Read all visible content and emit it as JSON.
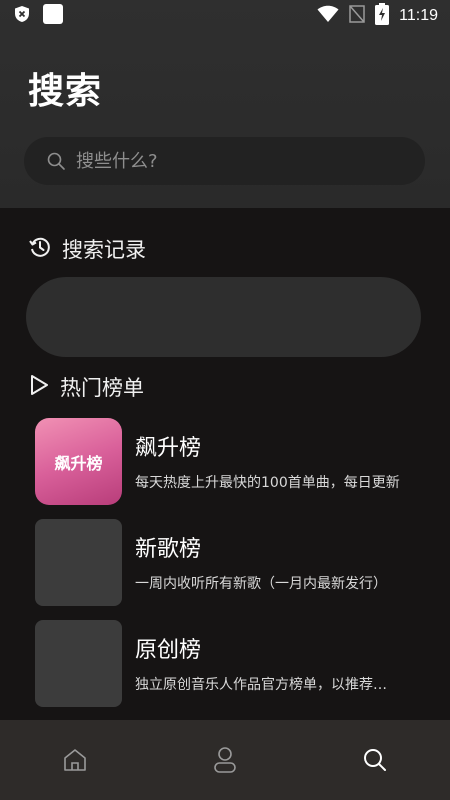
{
  "status_bar": {
    "time": "11:19",
    "icons": [
      "shield-x-icon",
      "square-notification-icon",
      "wifi-icon",
      "no-signal-icon",
      "battery-charging-icon"
    ]
  },
  "page": {
    "title": "搜索"
  },
  "search": {
    "placeholder": "搜些什么?"
  },
  "history": {
    "heading": "搜索记录",
    "icon": "history-icon"
  },
  "hot": {
    "heading": "热门榜单",
    "icon": "play-outline-icon",
    "charts": [
      {
        "name": "飙升榜",
        "cover_text": "飙升榜",
        "desc": "每天热度上升最快的100首单曲，每日更新",
        "cover_color": "#d9609a"
      },
      {
        "name": "新歌榜",
        "cover_text": "",
        "desc": "一周内收听所有新歌（一月内最新发行）",
        "cover_color": "#3c3c3c"
      },
      {
        "name": "原创榜",
        "cover_text": "",
        "desc": "独立原创音乐人作品官方榜单，以推荐指数为依据",
        "cover_color": "#3c3c3c"
      }
    ]
  },
  "bottom_nav": {
    "items": [
      "home-icon",
      "profile-icon",
      "search-icon"
    ],
    "active": "search-icon"
  }
}
